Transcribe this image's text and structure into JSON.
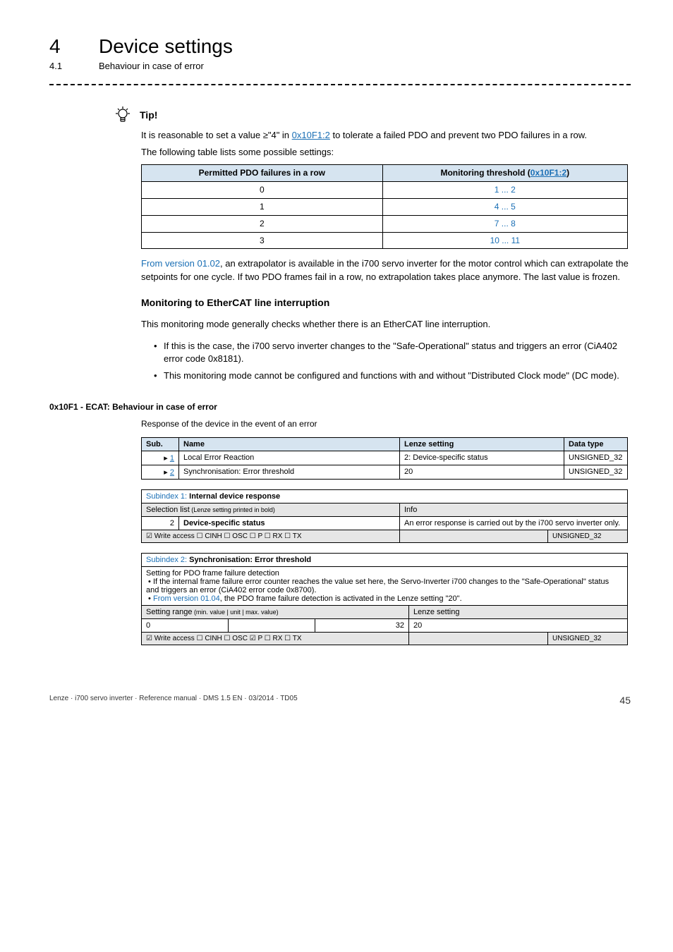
{
  "header": {
    "chapter_num": "4",
    "chapter_title": "Device settings",
    "section_num": "4.1",
    "section_title": "Behaviour in case of error"
  },
  "tip": {
    "label": "Tip!",
    "line1_pre": "It is reasonable to set a value ≥\"4\" in ",
    "line1_link": "0x10F1:2",
    "line1_post": " to tolerate a failed PDO and prevent two PDO failures in a row.",
    "line2": "The following table lists some possible settings:",
    "table": {
      "col1_header": "Permitted PDO failures in a row",
      "col2_header_pre": "Monitoring threshold (",
      "col2_header_link": "0x10F1:2",
      "col2_header_post": ")",
      "rows": [
        {
          "c1": "0",
          "c2": "1 ... 2"
        },
        {
          "c1": "1",
          "c2": "4 ... 5"
        },
        {
          "c1": "2",
          "c2": "7 ... 8"
        },
        {
          "c1": "3",
          "c2": "10 ... 11"
        }
      ]
    }
  },
  "extrap": {
    "prefix": "From version 01.02",
    "rest": ", an extrapolator is available in the i700 servo inverter for the motor control which can extrapolate the setpoints for one cycle. If two PDO frames fail in a row, no extrapolation takes place anymore. The last value is frozen."
  },
  "monitoring": {
    "heading": "Monitoring to EtherCAT line interruption",
    "intro": "This monitoring mode generally checks whether there is an EtherCAT line interruption.",
    "bullets": [
      "If this is the case, the i700 servo inverter changes to the \"Safe-Operational\" status and triggers an error (CiA402 error code 0x8181).",
      "This monitoring mode cannot be configured and functions with and without \"Distributed Clock mode\" (DC mode)."
    ]
  },
  "obj": {
    "title": "0x10F1 - ECAT: Behaviour in case of error",
    "desc": "Response of the device in the event of an error",
    "headers": {
      "sub": "Sub.",
      "name": "Name",
      "lenze": "Lenze setting",
      "dtype": "Data type"
    },
    "rows": [
      {
        "sub_link": "1",
        "name": "Local Error Reaction",
        "lenze": "2: Device-specific status",
        "dtype": "UNSIGNED_32"
      },
      {
        "sub_link": "2",
        "name": "Synchronisation: Error threshold",
        "lenze": "20",
        "dtype": "UNSIGNED_32"
      }
    ]
  },
  "sub1": {
    "title_prefix": "Subindex 1: ",
    "title_bold": "Internal device response",
    "sel_label": "Selection list",
    "sel_note": " (Lenze setting printed in bold)",
    "info_label": "Info",
    "val_num": "2",
    "val_text": "Device-specific status",
    "info_text": "An error response is carried out by the i700 servo inverter only.",
    "access": "☑ Write access  ☐ CINH  ☐ OSC  ☐ P  ☐ RX  ☐ TX",
    "unit": "UNSIGNED_32"
  },
  "sub2": {
    "title_prefix": "Subindex 2: ",
    "title_bold": "Synchronisation: Error threshold",
    "desc_l1": "Setting for PDO frame failure detection",
    "desc_b1": "If the internal frame failure error counter reaches the value set here, the Servo-Inverter i700 changes to the \"Safe-Operational\" status and triggers an error (CiA402 error code 0x8700).",
    "desc_b2_prefix": "From version 01.04",
    "desc_b2_rest": ", the PDO frame failure detection is activated in the Lenze setting \"20\".",
    "range_label": "Setting range",
    "range_note": " (min. value | unit | max. value)",
    "lenze_label": "Lenze setting",
    "min": "0",
    "unit_col": "",
    "max": "32",
    "lenze_val": "20",
    "access": "☑ Write access  ☐ CINH  ☐ OSC  ☑ P  ☐ RX  ☐ TX",
    "access_unit": "UNSIGNED_32"
  },
  "chart_data": {
    "type": "table",
    "title": "Permitted PDO failures vs monitoring threshold",
    "columns": [
      "Permitted PDO failures in a row",
      "Monitoring threshold (0x10F1:2)"
    ],
    "rows": [
      [
        0,
        "1 ... 2"
      ],
      [
        1,
        "4 ... 5"
      ],
      [
        2,
        "7 ... 8"
      ],
      [
        3,
        "10 ... 11"
      ]
    ]
  },
  "footer": {
    "left": "Lenze · i700 servo inverter · Reference manual · DMS 1.5 EN · 03/2014 · TD05",
    "page": "45"
  }
}
